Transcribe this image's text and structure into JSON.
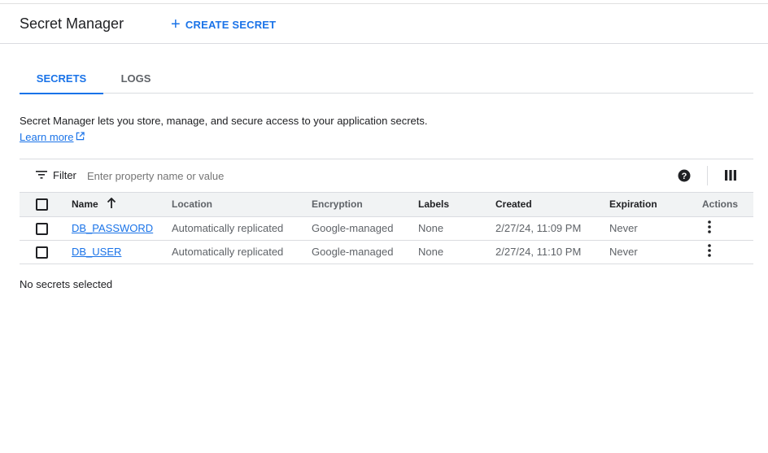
{
  "header": {
    "title": "Secret Manager",
    "create_label": "CREATE SECRET"
  },
  "tabs": [
    {
      "label": "SECRETS",
      "active": true
    },
    {
      "label": "LOGS",
      "active": false
    }
  ],
  "description": "Secret Manager lets you store, manage, and secure access to your application secrets.",
  "learn_more": "Learn more",
  "filter": {
    "label": "Filter",
    "placeholder": "Enter property name or value"
  },
  "table": {
    "columns": [
      "Name",
      "Location",
      "Encryption",
      "Labels",
      "Created",
      "Expiration",
      "Actions"
    ],
    "rows": [
      {
        "name": "DB_PASSWORD",
        "location": "Automatically replicated",
        "encryption": "Google-managed",
        "labels": "None",
        "created": "2/27/24, 11:09 PM",
        "expiration": "Never"
      },
      {
        "name": "DB_USER",
        "location": "Automatically replicated",
        "encryption": "Google-managed",
        "labels": "None",
        "created": "2/27/24, 11:10 PM",
        "expiration": "Never"
      }
    ]
  },
  "selection_status": "No secrets selected",
  "icons": {
    "create": "plus-icon",
    "external": "external-link-icon",
    "filter": "filter-icon",
    "help": "help-icon",
    "columns": "column-display-icon",
    "sort": "arrow-up-icon",
    "actions": "more-vert-icon"
  },
  "colors": {
    "accent": "#1a73e8",
    "text": "#202124",
    "muted": "#5f6368",
    "border": "#dadce0",
    "header_bg": "#f1f3f4"
  }
}
